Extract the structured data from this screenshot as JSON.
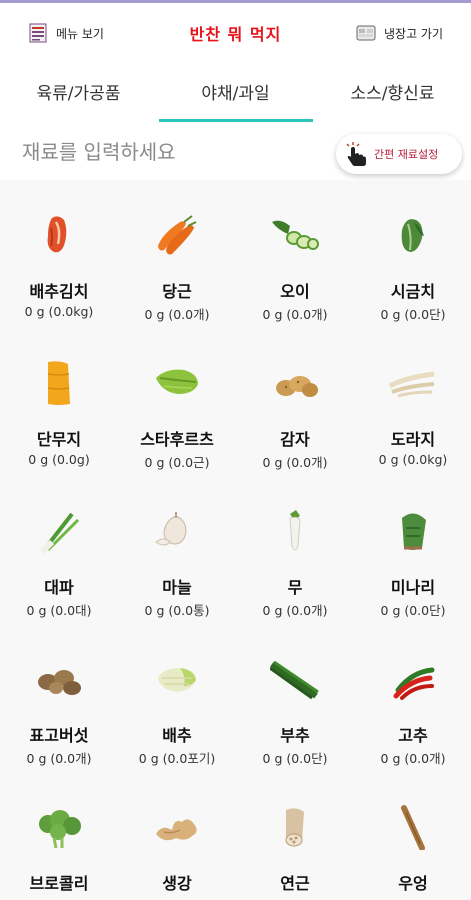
{
  "header": {
    "menu_label": "메뉴 보기",
    "title": "반찬 뭐 먹지",
    "fridge_label": "냉장고 가기"
  },
  "tabs": [
    {
      "label": "육류/가공품"
    },
    {
      "label": "야채/과일"
    },
    {
      "label": "소스/향신료"
    }
  ],
  "search": {
    "placeholder": "재료를 입력하세요",
    "quick_label": "간편 재료설정"
  },
  "items": [
    {
      "name": "배추김치",
      "amount": "0 g  (0.0kg)",
      "icon": "kimchi"
    },
    {
      "name": "당근",
      "amount": "0 g  (0.0개)",
      "icon": "carrot"
    },
    {
      "name": "오이",
      "amount": "0 g  (0.0개)",
      "icon": "cucumber"
    },
    {
      "name": "시금치",
      "amount": "0 g  (0.0단)",
      "icon": "spinach"
    },
    {
      "name": "단무지",
      "amount": "0 g  (0.0g)",
      "icon": "pickled-radish"
    },
    {
      "name": "스타후르츠",
      "amount": "0 g  (0.0근)",
      "icon": "starfruit"
    },
    {
      "name": "감자",
      "amount": "0 g  (0.0개)",
      "icon": "potato"
    },
    {
      "name": "도라지",
      "amount": "0 g  (0.0kg)",
      "icon": "bellflower-root"
    },
    {
      "name": "대파",
      "amount": "0 g  (0.0대)",
      "icon": "green-onion"
    },
    {
      "name": "마늘",
      "amount": "0 g  (0.0통)",
      "icon": "garlic"
    },
    {
      "name": "무",
      "amount": "0 g  (0.0개)",
      "icon": "radish"
    },
    {
      "name": "미나리",
      "amount": "0 g  (0.0단)",
      "icon": "water-parsley"
    },
    {
      "name": "표고버섯",
      "amount": "0 g  (0.0개)",
      "icon": "shiitake"
    },
    {
      "name": "배추",
      "amount": "0 g  (0.0포기)",
      "icon": "napa-cabbage"
    },
    {
      "name": "부추",
      "amount": "0 g  (0.0단)",
      "icon": "chives"
    },
    {
      "name": "고추",
      "amount": "0 g  (0.0개)",
      "icon": "chili-pepper"
    },
    {
      "name": "브로콜리",
      "amount": "",
      "icon": "broccoli"
    },
    {
      "name": "생강",
      "amount": "",
      "icon": "ginger"
    },
    {
      "name": "연근",
      "amount": "",
      "icon": "lotus-root"
    },
    {
      "name": "우엉",
      "amount": "",
      "icon": "burdock"
    }
  ],
  "colors": {
    "title": "#e8131b",
    "tab_indicator": "#2cc6bc",
    "quick_label": "#b8243c"
  }
}
